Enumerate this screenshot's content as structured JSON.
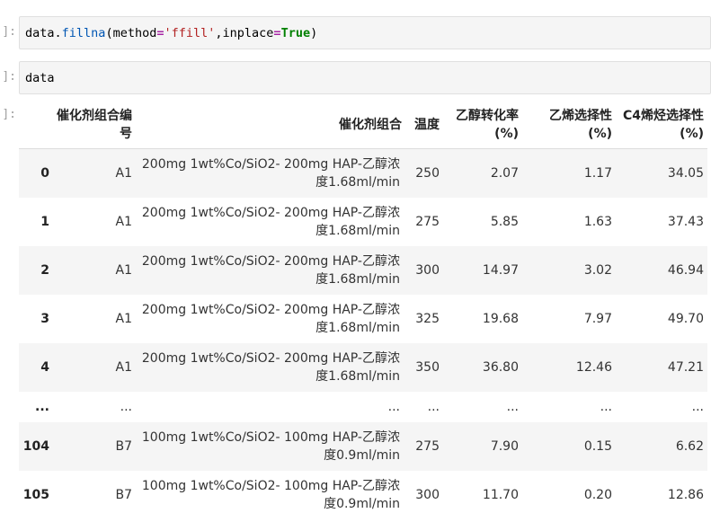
{
  "cells": [
    {
      "prompt": "]:",
      "code_tokens": [
        "data",
        ".",
        "fillna",
        "(method",
        "=",
        "'ffill'",
        ",inplace",
        "=",
        "True",
        ")"
      ]
    },
    {
      "prompt": "]:",
      "code": "data"
    }
  ],
  "output_prompt": "]:",
  "dataframe": {
    "columns": [
      "催化剂组合编号",
      "催化剂组合",
      "温度",
      "乙醇转化率(%)",
      "乙烯选择性(%)",
      "C4烯烃选择性(%)"
    ],
    "rows": [
      {
        "index": "0",
        "id": "A1",
        "combo": "200mg 1wt%Co/SiO2- 200mg HAP-乙醇浓度1.68ml/min",
        "temp": "250",
        "conv": "2.07",
        "ethylene": "1.17",
        "c4": "34.05"
      },
      {
        "index": "1",
        "id": "A1",
        "combo": "200mg 1wt%Co/SiO2- 200mg HAP-乙醇浓度1.68ml/min",
        "temp": "275",
        "conv": "5.85",
        "ethylene": "1.63",
        "c4": "37.43"
      },
      {
        "index": "2",
        "id": "A1",
        "combo": "200mg 1wt%Co/SiO2- 200mg HAP-乙醇浓度1.68ml/min",
        "temp": "300",
        "conv": "14.97",
        "ethylene": "3.02",
        "c4": "46.94"
      },
      {
        "index": "3",
        "id": "A1",
        "combo": "200mg 1wt%Co/SiO2- 200mg HAP-乙醇浓度1.68ml/min",
        "temp": "325",
        "conv": "19.68",
        "ethylene": "7.97",
        "c4": "49.70"
      },
      {
        "index": "4",
        "id": "A1",
        "combo": "200mg 1wt%Co/SiO2- 200mg HAP-乙醇浓度1.68ml/min",
        "temp": "350",
        "conv": "36.80",
        "ethylene": "12.46",
        "c4": "47.21"
      },
      {
        "index": "...",
        "id": "...",
        "combo": "...",
        "temp": "...",
        "conv": "...",
        "ethylene": "...",
        "c4": "..."
      },
      {
        "index": "104",
        "id": "B7",
        "combo": "100mg 1wt%Co/SiO2- 100mg HAP-乙醇浓度0.9ml/min",
        "temp": "275",
        "conv": "7.90",
        "ethylene": "0.15",
        "c4": "6.62"
      },
      {
        "index": "105",
        "id": "B7",
        "combo": "100mg 1wt%Co/SiO2- 100mg HAP-乙醇浓度0.9ml/min",
        "temp": "300",
        "conv": "11.70",
        "ethylene": "0.20",
        "c4": "12.86"
      }
    ]
  }
}
